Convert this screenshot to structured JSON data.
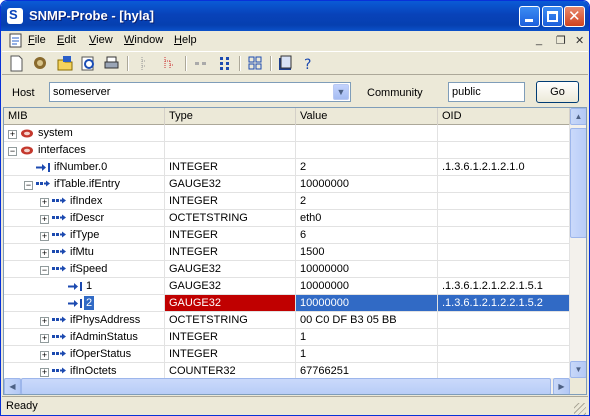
{
  "window": {
    "title": "SNMP-Probe - [hyla]",
    "app_icon": "S"
  },
  "menu": [
    {
      "key": "F",
      "rest": "ile"
    },
    {
      "key": "E",
      "rest": "dit"
    },
    {
      "key": "V",
      "rest": "iew"
    },
    {
      "key": "W",
      "rest": "indow"
    },
    {
      "key": "H",
      "rest": "elp"
    }
  ],
  "hostbar": {
    "host_label": "Host",
    "host_value": "someserver",
    "community_label": "Community",
    "community_value": "public",
    "go_label": "Go"
  },
  "columns": {
    "mib": "MIB",
    "type": "Type",
    "value": "Value",
    "oid": "OID"
  },
  "rows": [
    {
      "mib": "system",
      "type": "",
      "value": "",
      "oid": ""
    },
    {
      "mib": "interfaces",
      "type": "",
      "value": "",
      "oid": ""
    },
    {
      "mib": "ifNumber.0",
      "type": "INTEGER",
      "value": "2",
      "oid": ".1.3.6.1.2.1.2.1.0"
    },
    {
      "mib": "ifTable.ifEntry",
      "type": "GAUGE32",
      "value": "10000000",
      "oid": ""
    },
    {
      "mib": "ifIndex",
      "type": "INTEGER",
      "value": "2",
      "oid": ""
    },
    {
      "mib": "ifDescr",
      "type": "OCTETSTRING",
      "value": "eth0",
      "oid": ""
    },
    {
      "mib": "ifType",
      "type": "INTEGER",
      "value": "6",
      "oid": ""
    },
    {
      "mib": "ifMtu",
      "type": "INTEGER",
      "value": "1500",
      "oid": ""
    },
    {
      "mib": "ifSpeed",
      "type": "GAUGE32",
      "value": "10000000",
      "oid": ""
    },
    {
      "mib": "1",
      "type": "GAUGE32",
      "value": "10000000",
      "oid": ".1.3.6.1.2.1.2.2.1.5.1"
    },
    {
      "mib": "2",
      "type": "GAUGE32",
      "value": "10000000",
      "oid": ".1.3.6.1.2.1.2.2.1.5.2"
    },
    {
      "mib": "ifPhysAddress",
      "type": "OCTETSTRING",
      "value": " 00 C0 DF B3 05 BB",
      "oid": ""
    },
    {
      "mib": "ifAdminStatus",
      "type": "INTEGER",
      "value": "1",
      "oid": ""
    },
    {
      "mib": "ifOperStatus",
      "type": "INTEGER",
      "value": "1",
      "oid": ""
    },
    {
      "mib": "ifInOctets",
      "type": "COUNTER32",
      "value": "67766251",
      "oid": ""
    }
  ],
  "status": {
    "text": "Ready"
  },
  "colors": {
    "selection": "#316ac5",
    "error_cell": "#c00000",
    "titlebar": "#0842b9"
  }
}
